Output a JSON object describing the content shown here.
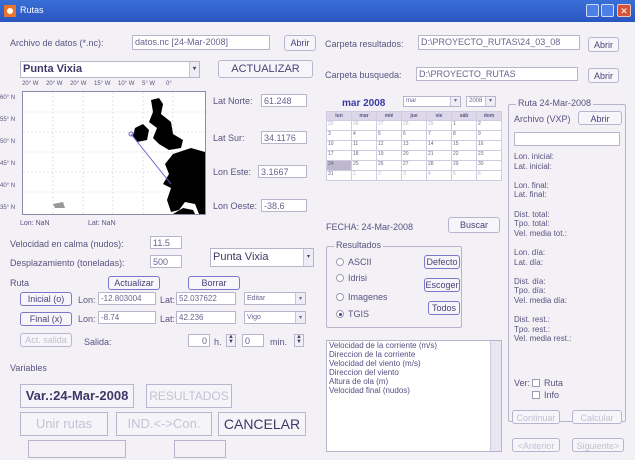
{
  "window": {
    "title": "Rutas"
  },
  "file": {
    "label": "Archivo de datos (*.nc):",
    "value": "datos.nc [24-Mar-2008]",
    "open": "Abrir"
  },
  "results_folder": {
    "label": "Carpeta resultados:",
    "value": "D:\\PROYECTO_RUTAS\\24_03_08",
    "open": "Abrir"
  },
  "search_folder": {
    "label": "Carpeta busqueda:",
    "value": "D:\\PROYECTO_RUTAS",
    "open": "Abrir"
  },
  "location_select": "Punta Vixia",
  "update_button": "ACTUALIZAR",
  "map": {
    "top_ticks": [
      "20° W",
      "20° W",
      "20° W",
      "15° W",
      "10° W",
      "5° W",
      "0°"
    ],
    "left_ticks": [
      "60° N",
      "55° N",
      "50° N",
      "45° N",
      "40° N",
      "35° N"
    ],
    "lon_text": "Lon: NaN",
    "lat_text": "Lat: NaN"
  },
  "coords": {
    "lat_norte_label": "Lat Norte:",
    "lat_norte": "61.248",
    "lat_sur_label": "Lat Sur:",
    "lat_sur": "34.1176",
    "lon_este_label": "Lon Este:",
    "lon_este": "3.1667",
    "lon_oeste_label": "Lon Oeste:",
    "lon_oeste": "-38.6"
  },
  "calendar": {
    "title": "mar 2008",
    "month_select": "mar",
    "year_select": "2008",
    "headers": [
      "lun",
      "mar",
      "mié",
      "jue",
      "vie",
      "sáb",
      "dom"
    ],
    "rows": [
      [
        "25",
        "26",
        "27",
        "28",
        "29",
        "1",
        "2"
      ],
      [
        "3",
        "4",
        "5",
        "6",
        "7",
        "8",
        "9"
      ],
      [
        "10",
        "11",
        "12",
        "13",
        "14",
        "15",
        "16"
      ],
      [
        "17",
        "18",
        "19",
        "20",
        "21",
        "22",
        "23"
      ],
      [
        "24",
        "25",
        "26",
        "27",
        "28",
        "29",
        "30"
      ],
      [
        "31",
        "1",
        "2",
        "3",
        "4",
        "5",
        "6"
      ]
    ]
  },
  "fecha": {
    "text": "FECHA: 24-Mar-2008",
    "search": "Buscar"
  },
  "ruta_panel": {
    "title": "Ruta 24-Mar-2008",
    "file_label": "Archivo (VXP)",
    "open": "Abrir",
    "lines": [
      "Lon. inicial:",
      "Lat. inicial:",
      "",
      "Lon. final:",
      "Lat. final:",
      "",
      "Dist. total:",
      "Tpo. total:",
      "Vel. media tot.:",
      "",
      "Lon. día:",
      "Lat. día:",
      "",
      "Dist. día:",
      "Tpo. día:",
      "Vel. media día:",
      "",
      "Dist. rest.:",
      "Tpo. rest.:",
      "Vel. media rest.:"
    ],
    "ver_label": "Ver:",
    "ruta_chk": "Ruta",
    "info_chk": "Info",
    "continuar": "Continuar",
    "calcular": "Calcular",
    "anterior": "<Anterior",
    "siguiente": "Siguiente>"
  },
  "velocidad": {
    "label": "Velocidad en calma (nudos):",
    "value": "11.5"
  },
  "desplazamiento": {
    "label": "Desplazamiento (toneladas):",
    "value": "500"
  },
  "second_location": "Punta Vixia",
  "ruta": {
    "label": "Ruta",
    "actualizar": "Actualizar",
    "borrar": "Borrar",
    "inicial": "Inicial (o)",
    "final": "Final (x)",
    "lon_label": "Lon:",
    "lat_label": "Lat:",
    "ini_lon": "-12.803004",
    "ini_lat": "52.037622",
    "ini_select": "Editar",
    "fin_lon": "-8.74",
    "fin_lat": "42.236",
    "fin_select": "Vigo",
    "act_salida": "Act. salida",
    "salida_label": "Salida:",
    "hour": "0",
    "h_label": "h.",
    "minute": "0",
    "min_label": "min."
  },
  "resultados": {
    "title": "Resultados",
    "ascii": "ASCII",
    "idrisi": "Idrisi",
    "imagenes": "Imagenes",
    "tgis": "TGIS",
    "defecto": "Defecto",
    "escoger": "Escoger",
    "todos": "Todos"
  },
  "variables_label": "Variables",
  "variables_list": [
    "Velocidad de la corriente (m/s)",
    "Direccion de la corriente",
    "Velocidad del viento (m/s)",
    "Direccion del viento",
    "Altura de ola (m)",
    "Velocidad final (nudos)"
  ],
  "bottom": {
    "var_button": "Var.:24-Mar-2008",
    "resultados_button": "RESULTADOS",
    "unir": "Unir rutas",
    "ind": "IND.<->Con.",
    "cancelar": "CANCELAR"
  }
}
